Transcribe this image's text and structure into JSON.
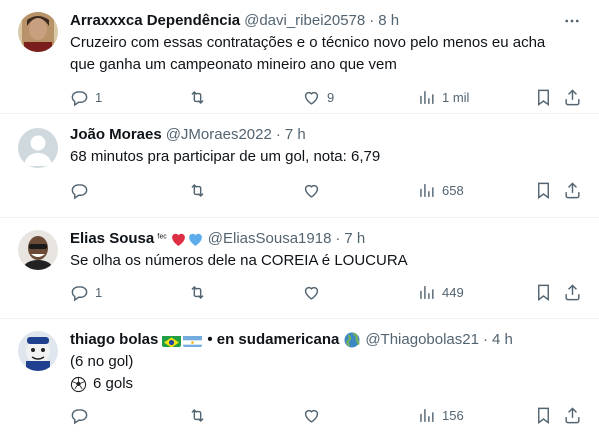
{
  "tweets": [
    {
      "name": "Arraxxxca Dependência",
      "handle": "@davi_ribei20578",
      "sep": "·",
      "time": "8 h",
      "lines": [
        "Cruzeiro com essas contratações e o técnico novo pelo menos eu acha",
        "que ganha um campeonato mineiro ano que vem"
      ],
      "replies": "1",
      "retweets": "",
      "likes": "9",
      "views": "1 mil"
    },
    {
      "name": "João Moraes",
      "handle": "@JMoraes2022",
      "sep": "·",
      "time": "7 h",
      "lines": [
        "68 minutos pra participar de um gol, nota: 6,79"
      ],
      "replies": "",
      "retweets": "",
      "likes": "",
      "views": "658"
    },
    {
      "name": "Elias Sousa",
      "name_badge": "ᶠᵉᶜ",
      "handle": "@EliasSousa1918",
      "sep": "·",
      "time": "7 h",
      "lines": [
        "Se olha os números dele na COREIA é LOUCURA"
      ],
      "replies": "1",
      "retweets": "",
      "likes": "",
      "views": "449"
    },
    {
      "name": "thiago bolas",
      "name_suffix": "• en sudamericana",
      "handle": "@Thiagobolas21",
      "sep": "·",
      "time": "4 h",
      "lines": [
        "(6 no gol)",
        "6 gols"
      ],
      "replies": "",
      "retweets": "",
      "likes": "",
      "views": "156"
    }
  ],
  "colors": {
    "text": "#0f1419",
    "muted": "#536471",
    "divider": "#eff3f4",
    "heart": "#e0245e",
    "blue_heart": "#5dadec"
  },
  "icons": [
    "reply-icon",
    "retweet-icon",
    "like-icon",
    "views-icon",
    "bookmark-icon",
    "share-icon",
    "more-icon",
    "globe-icon",
    "soccer-ball-icon"
  ]
}
